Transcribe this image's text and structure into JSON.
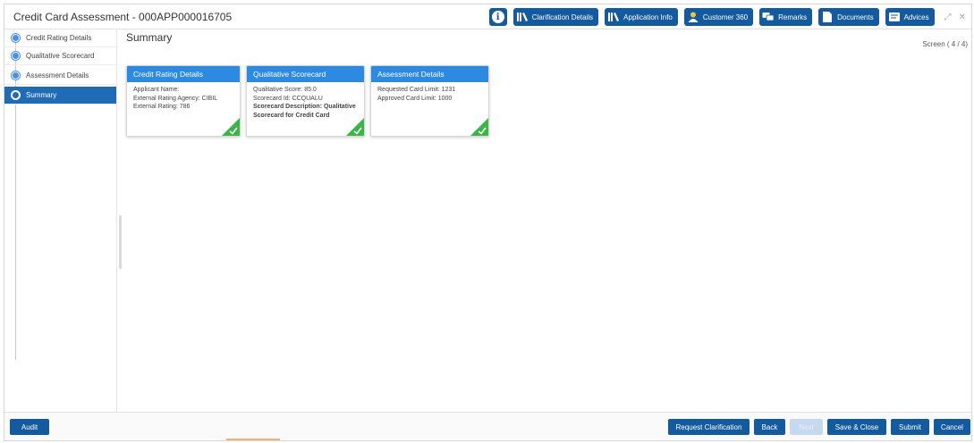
{
  "window": {
    "title": "Credit Card Assessment - 000APP000016705"
  },
  "toolbar": {
    "buttons": [
      {
        "label": "Clarification Details",
        "icon": "books-icon"
      },
      {
        "label": "Application Info",
        "icon": "books-icon"
      },
      {
        "label": "Customer 360",
        "icon": "person-icon"
      },
      {
        "label": "Remarks",
        "icon": "chat-icon"
      },
      {
        "label": "Documents",
        "icon": "document-icon"
      },
      {
        "label": "Advices",
        "icon": "advice-icon"
      }
    ]
  },
  "sidebar": {
    "steps": [
      {
        "label": "Credit Rating Details",
        "active": false
      },
      {
        "label": "Qualitative Scorecard",
        "active": false
      },
      {
        "label": "Assessment Details",
        "active": false
      },
      {
        "label": "Summary",
        "active": true
      }
    ]
  },
  "main": {
    "title": "Summary",
    "screen_indicator": "Screen ( 4 / 4)",
    "cards": [
      {
        "title": "Credit Rating Details",
        "lines": [
          "Applicant Name:",
          "External Rating Agency: CIBIL",
          "External Rating: 786"
        ],
        "complete": true
      },
      {
        "title": "Qualitative Scorecard",
        "lines": [
          "Qualitative Score: 85.0",
          "Scorecard Id: CCQUALU",
          "Scorecard Description: Qualitative Scorecard for Credit Card"
        ],
        "complete": true
      },
      {
        "title": "Assessment Details",
        "lines": [
          "Requested Card Limit: 1231",
          "Approved Card Limit: 1000"
        ],
        "complete": true
      }
    ]
  },
  "footer": {
    "audit": "Audit",
    "request_clarification": "Request Clarification",
    "back": "Back",
    "next": "Next",
    "save_close": "Save & Close",
    "submit": "Submit",
    "cancel": "Cancel"
  },
  "colors": {
    "primary": "#145a9e",
    "card_header": "#2d8ae0",
    "complete": "#3bb54a"
  }
}
